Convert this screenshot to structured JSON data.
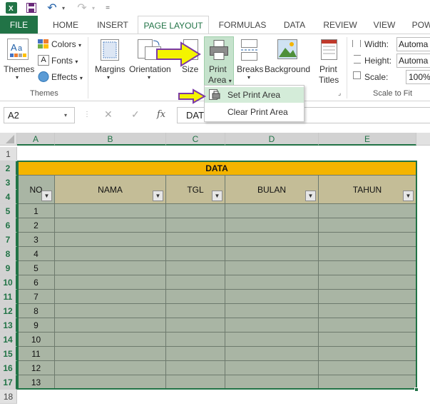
{
  "qat": {
    "undo": "↶",
    "redo": "↷",
    "customize": "="
  },
  "tabs": [
    {
      "label": "FILE"
    },
    {
      "label": "HOME"
    },
    {
      "label": "INSERT"
    },
    {
      "label": "PAGE LAYOUT"
    },
    {
      "label": "FORMULAS"
    },
    {
      "label": "DATA"
    },
    {
      "label": "REVIEW"
    },
    {
      "label": "VIEW"
    },
    {
      "label": "POW"
    }
  ],
  "ribbon": {
    "themes": {
      "label": "Themes",
      "colors": "Colors",
      "fonts": "Fonts",
      "effects": "Effects",
      "group": "Themes"
    },
    "margins": "Margins",
    "orientation": "Orientation",
    "size": "Size",
    "print_area": {
      "line1": "Print",
      "line2": "Area"
    },
    "breaks": "Breaks",
    "background": "Background",
    "print_titles": {
      "line1": "Print",
      "line2": "Titles"
    },
    "scale_to_fit": {
      "width_label": "Width:",
      "width_value": "Automa",
      "height_label": "Height:",
      "height_value": "Automa",
      "scale_label": "Scale:",
      "scale_value": "100%",
      "group": "Scale to Fit"
    }
  },
  "menu": {
    "set_print_area": "Set Print Area",
    "clear_print_area": "Clear Print Area"
  },
  "formula_bar": {
    "name_box": "A2",
    "content": "DAT",
    "fx": "fx"
  },
  "sheet": {
    "columns": [
      "A",
      "B",
      "C",
      "D",
      "E"
    ],
    "rows": [
      "1",
      "2",
      "3",
      "4",
      "5",
      "6",
      "7",
      "8",
      "9",
      "10",
      "11",
      "12",
      "13",
      "14",
      "15",
      "16",
      "17",
      "18"
    ],
    "title": "DATA",
    "headers": [
      "NO",
      "NAMA",
      "TGL",
      "BULAN",
      "TAHUN"
    ],
    "numbers": [
      "1",
      "2",
      "3",
      "4",
      "5",
      "6",
      "7",
      "8",
      "9",
      "10",
      "11",
      "12",
      "13"
    ]
  },
  "colors": {
    "excel_green": "#217346",
    "title_fill": "#f4b400",
    "header_fill": "#c4bd97",
    "body_fill": "#a9b5a4",
    "arrow": "#f4f400"
  }
}
